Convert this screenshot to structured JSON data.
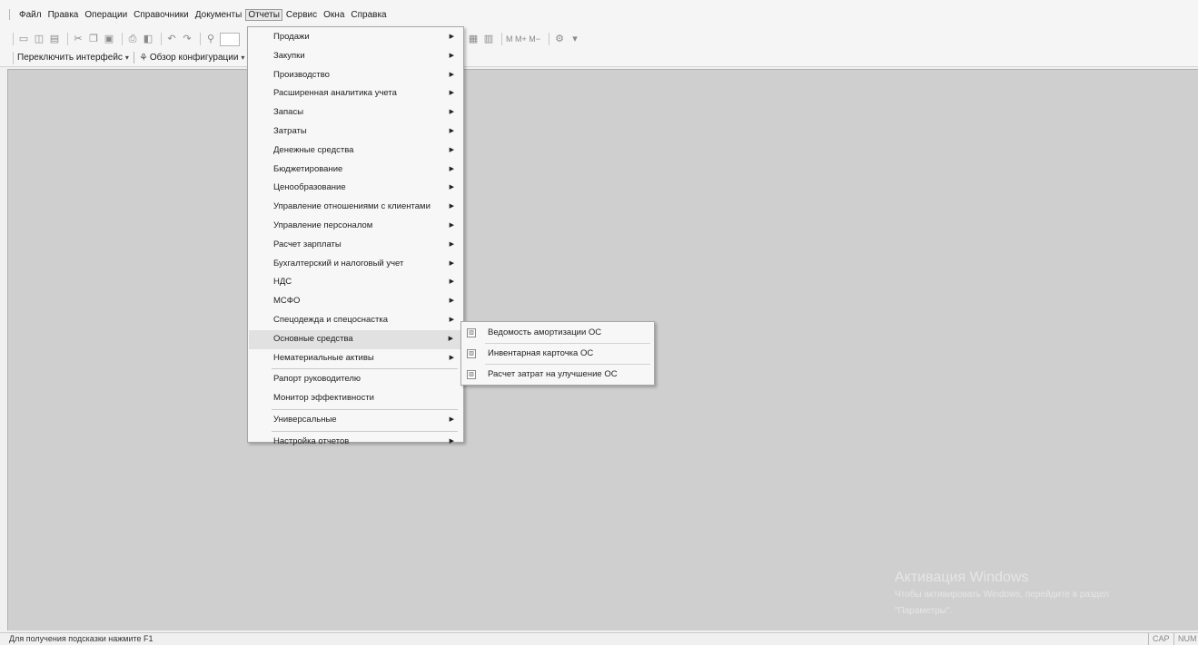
{
  "menubar": {
    "items": [
      {
        "label": "Файл"
      },
      {
        "label": "Правка"
      },
      {
        "label": "Операции"
      },
      {
        "label": "Справочники"
      },
      {
        "label": "Документы"
      },
      {
        "label": "Отчеты"
      },
      {
        "label": "Сервис"
      },
      {
        "label": "Окна"
      },
      {
        "label": "Справка"
      }
    ]
  },
  "toolbar": {
    "right_text": "М М+ М−"
  },
  "toolbar2": {
    "switch_interface": "Переключить интерфейс",
    "config_overview": "Обзор конфигурации"
  },
  "reports_menu": {
    "items": [
      {
        "label": "Продажи"
      },
      {
        "label": "Закупки"
      },
      {
        "label": "Производство"
      },
      {
        "label": "Расширенная аналитика учета"
      },
      {
        "label": "Запасы"
      },
      {
        "label": "Затраты"
      },
      {
        "label": "Денежные средства"
      },
      {
        "label": "Бюджетирование"
      },
      {
        "label": "Ценообразование"
      },
      {
        "label": "Управление отношениями с клиентами"
      },
      {
        "label": "Управление персоналом"
      },
      {
        "label": "Расчет зарплаты"
      },
      {
        "label": "Бухгалтерский и налоговый учет"
      },
      {
        "label": "НДС"
      },
      {
        "label": "МСФО"
      },
      {
        "label": "Спецодежда и спецоснастка"
      },
      {
        "label": "Основные средства"
      },
      {
        "label": "Нематериальные активы"
      },
      {
        "label": "Рапорт руководителю"
      },
      {
        "label": "Монитор эффективности"
      },
      {
        "label": "Универсальные"
      },
      {
        "label": "Настройка отчетов"
      }
    ]
  },
  "fixed_assets_submenu": {
    "items": [
      {
        "label": "Ведомость амортизации ОС"
      },
      {
        "label": "Инвентарная карточка ОС"
      },
      {
        "label": "Расчет затрат на улучшение ОС"
      }
    ]
  },
  "watermark": {
    "title": "Активация Windows",
    "line1": "Чтобы активировать Windows, перейдите в раздел",
    "line2": "\"Параметры\"."
  },
  "statusbar": {
    "hint": "Для получения подсказки нажмите F1",
    "cap": "CAP",
    "num": "NUM"
  }
}
